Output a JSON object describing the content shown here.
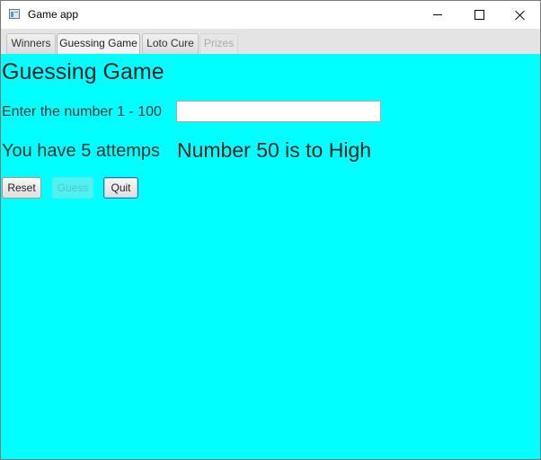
{
  "window": {
    "title": "Game app"
  },
  "tabs": [
    {
      "label": "Winners",
      "state": "normal"
    },
    {
      "label": "Guessing Game",
      "state": "active"
    },
    {
      "label": "Loto Cure",
      "state": "normal"
    },
    {
      "label": "Prizes",
      "state": "disabled"
    }
  ],
  "game": {
    "heading": "Guessing Game",
    "prompt": "Enter the number 1 - 100",
    "input_value": "",
    "attempts_text": "You have 5 attemps",
    "result_text": "Number 50 is to High"
  },
  "buttons": {
    "reset": "Reset",
    "guess": "Guess",
    "quit": "Quit"
  },
  "colors": {
    "background": "#00ffff",
    "guess_disabled": "#4ff1f1"
  },
  "icons": {
    "app": "app-window-icon",
    "minimize": "minimize-icon",
    "maximize": "maximize-icon",
    "close": "close-icon"
  }
}
